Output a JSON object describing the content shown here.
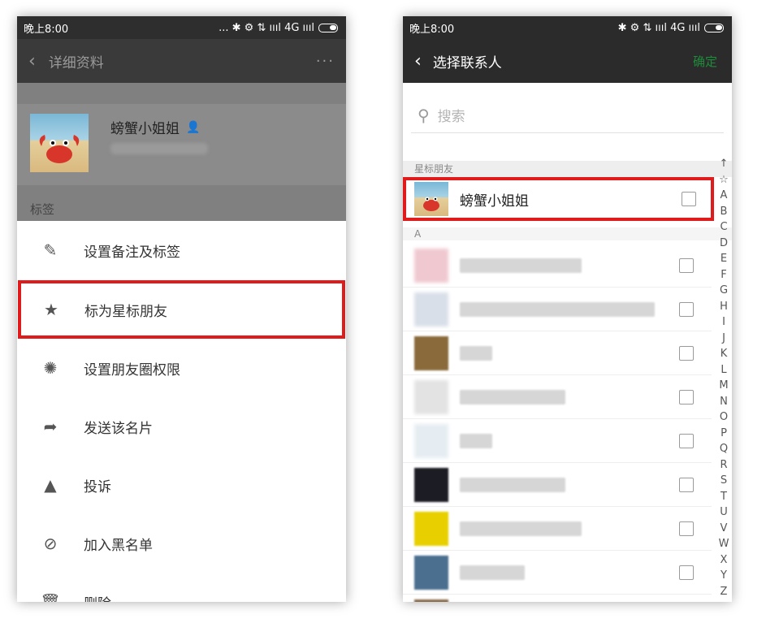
{
  "left": {
    "status": {
      "time": "晚上8:00",
      "right": "... ✱ ⚙ ⇅ ıııl 4G ıııl"
    },
    "title_bar": {
      "back": "‹",
      "title": "详细资料",
      "more": "···"
    },
    "profile": {
      "name": "螃蟹小姐姐",
      "tag_label": "标签"
    },
    "menu": [
      {
        "label": "设置备注及标签",
        "icon": "✎"
      },
      {
        "label": "标为星标朋友",
        "icon": "★"
      },
      {
        "label": "设置朋友圈权限",
        "icon": "✺"
      },
      {
        "label": "发送该名片",
        "icon": "➦"
      },
      {
        "label": "投诉",
        "icon": "▲"
      },
      {
        "label": "加入黑名单",
        "icon": "⊘"
      },
      {
        "label": "删除",
        "icon": "🗑"
      }
    ]
  },
  "right": {
    "status": {
      "time": "晚上8:00",
      "right": "✱ ⚙ ⇅ ıııl 4G ıııl"
    },
    "title_bar": {
      "back": "‹",
      "title": "选择联系人",
      "confirm": "确定"
    },
    "search": {
      "placeholder": "搜索",
      "icon": "search-icon"
    },
    "sections": {
      "starred": "星标朋友",
      "a": "A"
    },
    "starred_contact": {
      "name": "螃蟹小姐姐"
    },
    "index_letters": [
      "↑",
      "☆",
      "A",
      "B",
      "C",
      "D",
      "E",
      "F",
      "G",
      "H",
      "I",
      "J",
      "K",
      "L",
      "M",
      "N",
      "O",
      "P",
      "Q",
      "R",
      "S",
      "T",
      "U",
      "V",
      "W",
      "X",
      "Y",
      "Z",
      "#"
    ]
  },
  "colors": {
    "highlight": "#e01b1b",
    "confirm": "#1e8b3a",
    "titlebar": "#2b2b2b"
  }
}
